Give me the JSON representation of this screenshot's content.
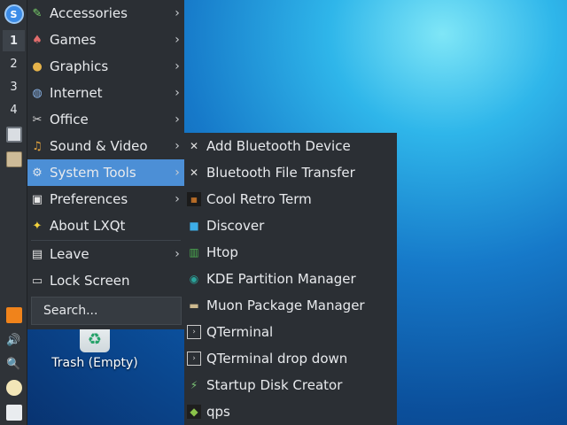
{
  "panel": {
    "start_logo": "S",
    "workspaces": [
      "1",
      "2",
      "3",
      "4"
    ],
    "active_workspace": "1"
  },
  "menu": {
    "items": [
      {
        "label": "Accessories",
        "icon": "accessories-icon",
        "has_submenu": true
      },
      {
        "label": "Games",
        "icon": "games-icon",
        "has_submenu": true
      },
      {
        "label": "Graphics",
        "icon": "graphics-icon",
        "has_submenu": true
      },
      {
        "label": "Internet",
        "icon": "internet-icon",
        "has_submenu": true
      },
      {
        "label": "Office",
        "icon": "office-icon",
        "has_submenu": true
      },
      {
        "label": "Sound & Video",
        "icon": "sound-video-icon",
        "has_submenu": true
      },
      {
        "label": "System Tools",
        "icon": "system-tools-icon",
        "has_submenu": true
      },
      {
        "label": "Preferences",
        "icon": "preferences-icon",
        "has_submenu": true
      },
      {
        "label": "About LXQt",
        "icon": "about-icon",
        "has_submenu": false
      },
      {
        "label": "Leave",
        "icon": "leave-icon",
        "has_submenu": true
      },
      {
        "label": "Lock Screen",
        "icon": "lock-screen-icon",
        "has_submenu": false
      }
    ],
    "selected": "System Tools",
    "search_placeholder": "Search..."
  },
  "submenu": {
    "items": [
      {
        "label": "Add Bluetooth Device",
        "icon": "tools-icon"
      },
      {
        "label": "Bluetooth File Transfer",
        "icon": "tools-icon"
      },
      {
        "label": "Cool Retro Term",
        "icon": "crt-icon"
      },
      {
        "label": "Discover",
        "icon": "discover-icon"
      },
      {
        "label": "Htop",
        "icon": "htop-icon"
      },
      {
        "label": "KDE Partition Manager",
        "icon": "partition-icon"
      },
      {
        "label": "Muon Package Manager",
        "icon": "package-icon"
      },
      {
        "label": "QTerminal",
        "icon": "terminal-icon"
      },
      {
        "label": "QTerminal drop down",
        "icon": "terminal-icon"
      },
      {
        "label": "Startup Disk Creator",
        "icon": "usb-icon"
      },
      {
        "label": "qps",
        "icon": "qps-icon"
      }
    ]
  },
  "desktop": {
    "trash_label": "Trash (Empty)"
  },
  "colors": {
    "menu_bg": "#2b2f34",
    "selection": "#4c8fd6",
    "panel_bg": "#2f3338"
  }
}
